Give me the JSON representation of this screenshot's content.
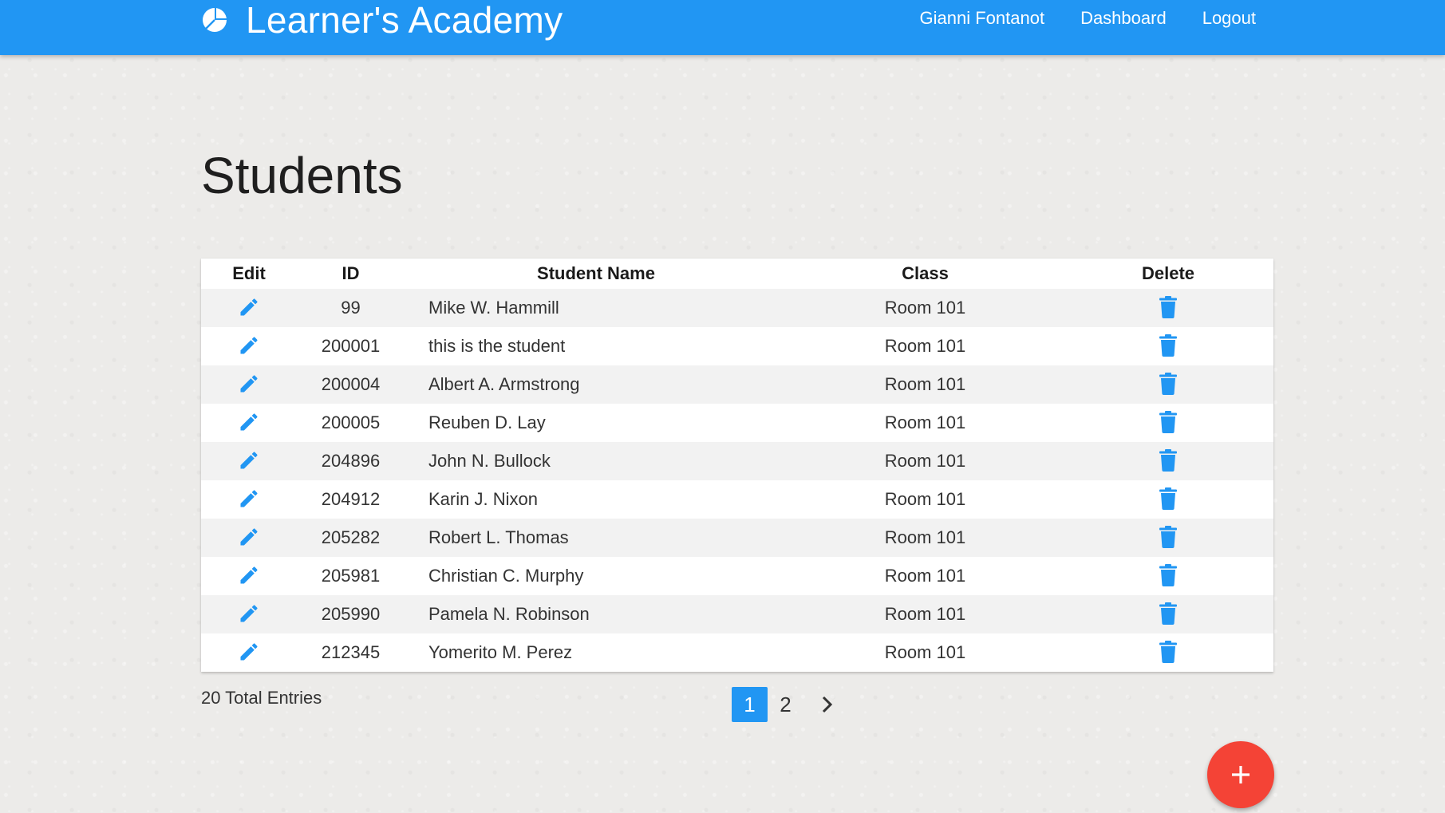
{
  "header": {
    "brand": "Learner's Academy",
    "brand_icon": "pie-chart-icon",
    "nav": [
      {
        "label": "Gianni Fontanot"
      },
      {
        "label": "Dashboard"
      },
      {
        "label": "Logout"
      }
    ]
  },
  "page": {
    "title": "Students"
  },
  "table": {
    "columns": [
      "Edit",
      "ID",
      "Student Name",
      "Class",
      "Delete"
    ],
    "edit_icon": "pencil-icon",
    "delete_icon": "trash-icon",
    "rows": [
      {
        "id": "99",
        "name": "Mike W. Hammill",
        "class": "Room 101"
      },
      {
        "id": "200001",
        "name": "this is the student",
        "class": "Room 101"
      },
      {
        "id": "200004",
        "name": "Albert A. Armstrong",
        "class": "Room 101"
      },
      {
        "id": "200005",
        "name": "Reuben D. Lay",
        "class": "Room 101"
      },
      {
        "id": "204896",
        "name": "John N. Bullock",
        "class": "Room 101"
      },
      {
        "id": "204912",
        "name": "Karin J. Nixon",
        "class": "Room 101"
      },
      {
        "id": "205282",
        "name": "Robert L. Thomas",
        "class": "Room 101"
      },
      {
        "id": "205981",
        "name": "Christian C. Murphy",
        "class": "Room 101"
      },
      {
        "id": "205990",
        "name": "Pamela N. Robinson",
        "class": "Room 101"
      },
      {
        "id": "212345",
        "name": "Yomerito M. Perez",
        "class": "Room 101"
      }
    ]
  },
  "footer": {
    "total_entries": "20 Total Entries",
    "pages": [
      "1",
      "2"
    ],
    "active_page": "1",
    "next_icon": "chevron-right-icon"
  },
  "fab": {
    "icon": "plus-icon"
  },
  "colors": {
    "primary": "#2196f3",
    "fab": "#f44336"
  }
}
